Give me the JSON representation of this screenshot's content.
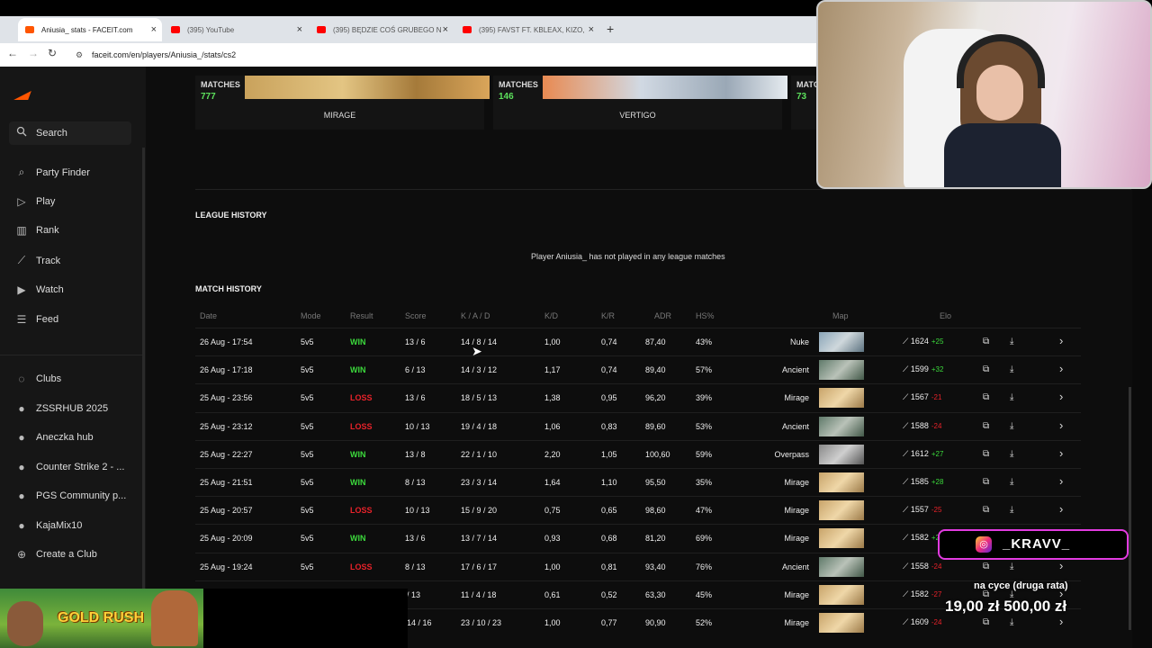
{
  "browser": {
    "tabs": [
      {
        "title": "Aniusia_ stats - FACEIT.com",
        "favicon_color": "#ff5500",
        "active": true
      },
      {
        "title": "(395) YouTube",
        "favicon_color": "#ff0000",
        "active": false
      },
      {
        "title": "(395) BĘDZIE COŚ GRUBEGO N",
        "favicon_color": "#ff0000",
        "active": false
      },
      {
        "title": "(395) FAVST FT. KBLEAX, KIZO,",
        "favicon_color": "#ff0000",
        "active": false
      }
    ],
    "url": "faceit.com/en/players/Aniusia_/stats/cs2"
  },
  "sidebar": {
    "search_label": "Search",
    "nav": [
      {
        "label": "Party Finder",
        "icon": "party-icon"
      },
      {
        "label": "Play",
        "icon": "play-icon"
      },
      {
        "label": "Rank",
        "icon": "rank-icon"
      },
      {
        "label": "Track",
        "icon": "track-icon"
      },
      {
        "label": "Watch",
        "icon": "watch-icon"
      },
      {
        "label": "Feed",
        "icon": "feed-icon"
      }
    ],
    "clubs": [
      {
        "label": "Clubs",
        "icon": "clubs-icon"
      },
      {
        "label": "ZSSRHUB 2025",
        "icon": "club-avatar"
      },
      {
        "label": "Aneczka hub",
        "icon": "club-avatar"
      },
      {
        "label": "Counter Strike 2 - ...",
        "icon": "club-avatar"
      },
      {
        "label": "PGS Community p...",
        "icon": "club-avatar"
      },
      {
        "label": "KajaMix10",
        "icon": "club-avatar"
      },
      {
        "label": "Create a Club",
        "icon": "plus-circle-icon"
      }
    ]
  },
  "maps": [
    {
      "matches_label": "MATCHES",
      "count": "777",
      "name": "MIRAGE"
    },
    {
      "matches_label": "MATCHES",
      "count": "146",
      "name": "VERTIGO"
    },
    {
      "matches_label": "MATCHES",
      "count": "73",
      "name": ""
    }
  ],
  "league": {
    "title": "LEAGUE HISTORY",
    "empty_message": "Player Aniusia_ has not played in any league matches"
  },
  "match_history": {
    "title": "MATCH HISTORY",
    "columns": [
      "Date",
      "Mode",
      "Result",
      "Score",
      "K / A / D",
      "K/D",
      "K/R",
      "ADR",
      "HS%",
      "Map",
      "Elo"
    ],
    "rows": [
      {
        "date": "26 Aug - 17:54",
        "mode": "5v5",
        "result": "WIN",
        "score": "13 / 6",
        "kad": "14 / 8 / 14",
        "kd": "1,00",
        "kr": "0,74",
        "adr": "87,40",
        "hs": "43%",
        "map": "Nuke",
        "elo": "1624",
        "delta": "+25"
      },
      {
        "date": "26 Aug - 17:18",
        "mode": "5v5",
        "result": "WIN",
        "score": "6 / 13",
        "kad": "14 / 3 / 12",
        "kd": "1,17",
        "kr": "0,74",
        "adr": "89,40",
        "hs": "57%",
        "map": "Ancient",
        "elo": "1599",
        "delta": "+32"
      },
      {
        "date": "25 Aug - 23:56",
        "mode": "5v5",
        "result": "LOSS",
        "score": "13 / 6",
        "kad": "18 / 5 / 13",
        "kd": "1,38",
        "kr": "0,95",
        "adr": "96,20",
        "hs": "39%",
        "map": "Mirage",
        "elo": "1567",
        "delta": "-21"
      },
      {
        "date": "25 Aug - 23:12",
        "mode": "5v5",
        "result": "LOSS",
        "score": "10 / 13",
        "kad": "19 / 4 / 18",
        "kd": "1,06",
        "kr": "0,83",
        "adr": "89,60",
        "hs": "53%",
        "map": "Ancient",
        "elo": "1588",
        "delta": "-24"
      },
      {
        "date": "25 Aug - 22:27",
        "mode": "5v5",
        "result": "WIN",
        "score": "13 / 8",
        "kad": "22 / 1 / 10",
        "kd": "2,20",
        "kr": "1,05",
        "adr": "100,60",
        "hs": "59%",
        "map": "Overpass",
        "elo": "1612",
        "delta": "+27"
      },
      {
        "date": "25 Aug - 21:51",
        "mode": "5v5",
        "result": "WIN",
        "score": "8 / 13",
        "kad": "23 / 3 / 14",
        "kd": "1,64",
        "kr": "1,10",
        "adr": "95,50",
        "hs": "35%",
        "map": "Mirage",
        "elo": "1585",
        "delta": "+28"
      },
      {
        "date": "25 Aug - 20:57",
        "mode": "5v5",
        "result": "LOSS",
        "score": "10 / 13",
        "kad": "15 / 9 / 20",
        "kd": "0,75",
        "kr": "0,65",
        "adr": "98,60",
        "hs": "47%",
        "map": "Mirage",
        "elo": "1557",
        "delta": "-25"
      },
      {
        "date": "25 Aug - 20:09",
        "mode": "5v5",
        "result": "WIN",
        "score": "13 / 6",
        "kad": "13 / 7 / 14",
        "kd": "0,93",
        "kr": "0,68",
        "adr": "81,20",
        "hs": "69%",
        "map": "Mirage",
        "elo": "1582",
        "delta": "+24"
      },
      {
        "date": "25 Aug - 19:24",
        "mode": "5v5",
        "result": "LOSS",
        "score": "8 / 13",
        "kad": "17 / 6 / 17",
        "kd": "1,00",
        "kr": "0,81",
        "adr": "93,40",
        "hs": "76%",
        "map": "Ancient",
        "elo": "1558",
        "delta": "-24"
      },
      {
        "date": "",
        "mode": "",
        "result": "",
        "score": "/ 13",
        "kad": "11 / 4 / 18",
        "kd": "0,61",
        "kr": "0,52",
        "adr": "63,30",
        "hs": "45%",
        "map": "Mirage",
        "elo": "1582",
        "delta": "-27"
      },
      {
        "date": "",
        "mode": "",
        "result": "",
        "score": "14 / 16",
        "kad": "23 / 10 / 23",
        "kd": "1,00",
        "kr": "0,77",
        "adr": "90,90",
        "hs": "52%",
        "map": "Mirage",
        "elo": "1609",
        "delta": "-24"
      }
    ]
  },
  "overlays": {
    "game_ad_title": "GOLD RUSH",
    "donation_name": "_KRAVV_",
    "goal_label": "na cyce (druga rata)",
    "goal_amount": "19,00 zł   500,00 zł"
  }
}
